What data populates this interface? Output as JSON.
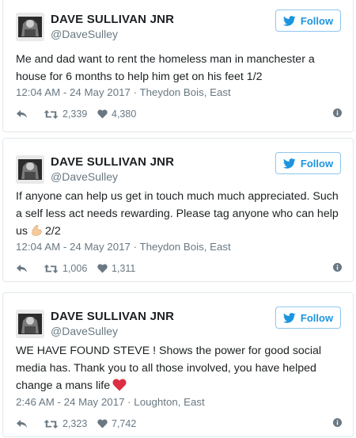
{
  "colors": {
    "follow_blue": "#1b95e0",
    "muted": "#697882",
    "text": "#1c2022",
    "border": "#e1e8ed",
    "heart": "#e0245e"
  },
  "icons": {
    "follow": "bird-icon",
    "reply": "reply-icon",
    "retweet": "retweet-icon",
    "like": "heart-icon",
    "info": "info-icon",
    "emoji_2": "flexed-biceps-emoji",
    "emoji_3": "red-heart-emoji"
  },
  "tweets": [
    {
      "name": "DAVE SULLIVAN JNR",
      "handle": "@DaveSulley",
      "follow": "Follow",
      "text": "Me and dad want to rent the homeless man in manchester a house for 6 months to help him get on his feet 1/2",
      "meta": "12:04 AM - 24 May 2017 · Theydon Bois, East",
      "retweets": "2,339",
      "likes": "4,380"
    },
    {
      "name": "DAVE SULLIVAN JNR",
      "handle": "@DaveSulley",
      "follow": "Follow",
      "text_before": "If anyone can help us get in touch much much appreciated. Such a self less act needs rewarding. Please tag anyone who can help us",
      "text_after": "2/2",
      "meta": "12:04 AM - 24 May 2017 · Theydon Bois, East",
      "retweets": "1,006",
      "likes": "1,311"
    },
    {
      "name": "DAVE SULLIVAN JNR",
      "handle": "@DaveSulley",
      "follow": "Follow",
      "text_before": "WE HAVE FOUND STEVE ! Shows the power for good social media has. Thank you to all those involved, you have helped change a mans life",
      "meta": "2:46 AM - 24 May 2017 · Loughton, East",
      "retweets": "2,323",
      "likes": "7,742"
    }
  ]
}
